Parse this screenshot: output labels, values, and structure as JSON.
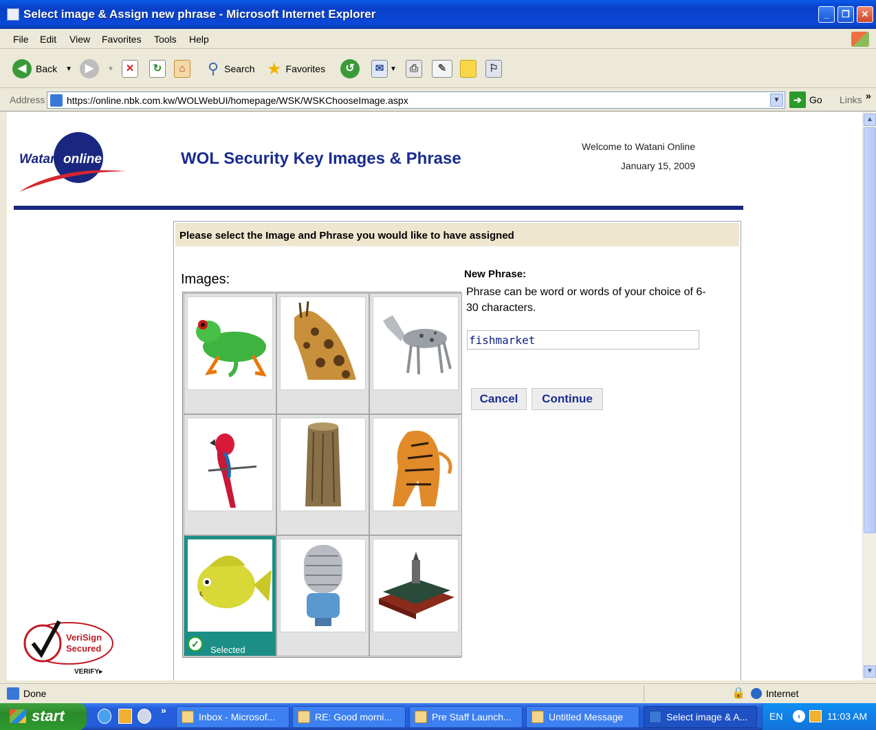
{
  "window": {
    "title": "Select image & Assign new phrase - Microsoft Internet Explorer",
    "minimize_label": "_",
    "restore_label": "❐",
    "close_label": "✕"
  },
  "menu": [
    "File",
    "Edit",
    "View",
    "Favorites",
    "Tools",
    "Help"
  ],
  "toolbar": {
    "back_label": "Back",
    "search_label": "Search",
    "favorites_label": "Favorites"
  },
  "address": {
    "label": "Address",
    "url": "https://online.nbk.com.kw/WOLWebUI/homepage/WSK/WSKChooseImage.aspx",
    "go_label": "Go",
    "links_label": "Links",
    "chevron": "»"
  },
  "page": {
    "logo_text_left": "Watani",
    "logo_text_right": "online",
    "title": "WOL Security Key Images & Phrase",
    "welcome": "Welcome to Watani Online",
    "date": "January 15, 2009",
    "panel_heading": "Please select the Image and Phrase you would like to have assigned",
    "images_label": "Images:",
    "new_phrase_label": "New Phrase:",
    "phrase_help": "Phrase can be word or words of your choice of 6-30 characters.",
    "phrase_value": "fishmarket",
    "cancel_label": "Cancel",
    "continue_label": "Continue",
    "selected_label": "Selected",
    "images": [
      {
        "name": "frog-image",
        "icon": "frog"
      },
      {
        "name": "giraffe-image",
        "icon": "giraffe"
      },
      {
        "name": "dog-image",
        "icon": "dog"
      },
      {
        "name": "parrot-image",
        "icon": "parrot"
      },
      {
        "name": "log-image",
        "icon": "log"
      },
      {
        "name": "tiger-image",
        "icon": "tiger"
      },
      {
        "name": "fish-image",
        "icon": "fish",
        "selected": true
      },
      {
        "name": "microphone-image",
        "icon": "microphone"
      },
      {
        "name": "books-image",
        "icon": "books"
      }
    ],
    "verisign_line1": "VeriSign",
    "verisign_line2": "Secured",
    "verisign_line3": "VERIFY▸"
  },
  "status": {
    "text": "Done",
    "zone": "Internet"
  },
  "taskbar": {
    "start_label": "start",
    "chevron": "»",
    "buttons": [
      {
        "label": "Inbox - Microsof...",
        "icon": "outlook-icon"
      },
      {
        "label": "RE: Good morni...",
        "icon": "mail-icon"
      },
      {
        "label": "Pre Staff Launch...",
        "icon": "mail-icon"
      },
      {
        "label": "Untitled Message",
        "icon": "mail-icon"
      },
      {
        "label": "Select image & A...",
        "icon": "ie-icon",
        "active": true
      }
    ],
    "lang": "EN",
    "time": "11:03 AM"
  },
  "colors": {
    "brand_navy": "#1a2780",
    "brand_red": "#d7262f",
    "selected_teal": "#1b8f86",
    "panel_heading_bg": "#efe6cf"
  }
}
